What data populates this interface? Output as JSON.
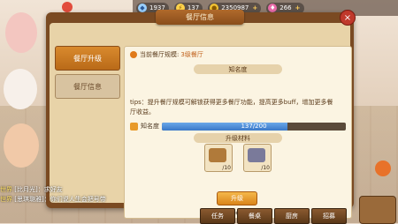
{
  "topbar": {
    "resources": [
      {
        "icon": "diamond-icon",
        "value": "1937"
      },
      {
        "icon": "energy-icon",
        "value": "137"
      },
      {
        "icon": "gold-icon",
        "value": "2350987"
      },
      {
        "icon": "gem-icon",
        "value": "266"
      }
    ]
  },
  "dialog": {
    "title": "餐厅信息",
    "tabs": [
      {
        "label": "餐厅升级"
      },
      {
        "label": "餐厅信息"
      }
    ],
    "scale_label": "当前餐厅规模:",
    "scale_value": "3级餐厅",
    "fame_section": "知名度",
    "tips": "tips：提升餐厅规模可解锁获得更多餐厅功能，提高更多buff，增加更多餐厅收益。",
    "fame_label": "知名度",
    "fame_text": "137/200",
    "fame_fraction": 0.685,
    "materials_section": "升级材料",
    "materials": [
      {
        "icon": "wood-plank-icon",
        "count": "/10",
        "color": "#b07a3a"
      },
      {
        "icon": "stone-icon",
        "count": "/10",
        "color": "#7a7a9a"
      }
    ],
    "upgrade_label": "升级",
    "cost": "20000"
  },
  "chat": [
    {
      "tag": "世界",
      "text": "[比月光]：求好友"
    },
    {
      "tag": "世界",
      "text": "[思琪璐雅]：你们说人生会把号带"
    }
  ],
  "menu": [
    {
      "label": "任务"
    },
    {
      "label": "餐桌"
    },
    {
      "label": "厨房"
    },
    {
      "label": "招募"
    }
  ]
}
